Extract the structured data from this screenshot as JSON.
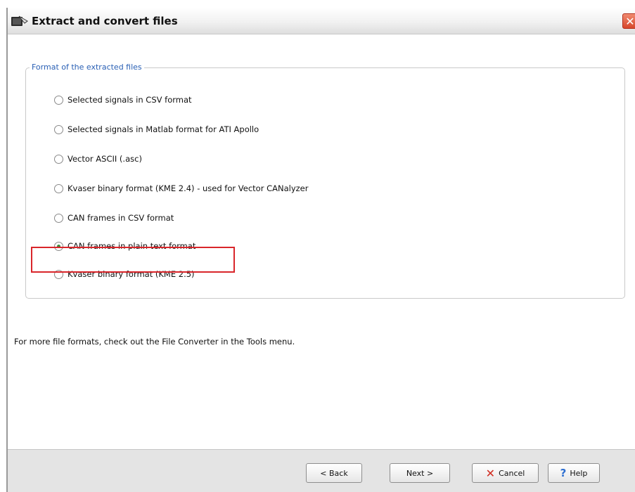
{
  "window": {
    "title": "Extract and convert files",
    "close_glyph": "✕"
  },
  "group": {
    "legend": "Format of the extracted files",
    "options": [
      {
        "label": "Selected signals in CSV format",
        "checked": false
      },
      {
        "label": "Selected signals in Matlab format for ATI Apollo",
        "checked": false
      },
      {
        "label": "Vector ASCII (.asc)",
        "checked": false
      },
      {
        "label": "Kvaser binary format (KME 2.4) - used for Vector CANalyzer",
        "checked": false
      },
      {
        "label": "CAN frames in CSV format",
        "checked": false
      },
      {
        "label": "CAN frames in plain text format",
        "checked": true
      },
      {
        "label": "Kvaser binary format (KME 2.5)",
        "checked": false
      }
    ]
  },
  "hint": "For more file formats, check out the File Converter in the Tools menu.",
  "buttons": {
    "back": "< Back",
    "next": "Next >",
    "cancel": "Cancel",
    "help": "Help",
    "cancel_icon": "✕",
    "help_icon": "?"
  },
  "colors": {
    "highlight": "#d9262b",
    "legend": "#2a60b5"
  }
}
